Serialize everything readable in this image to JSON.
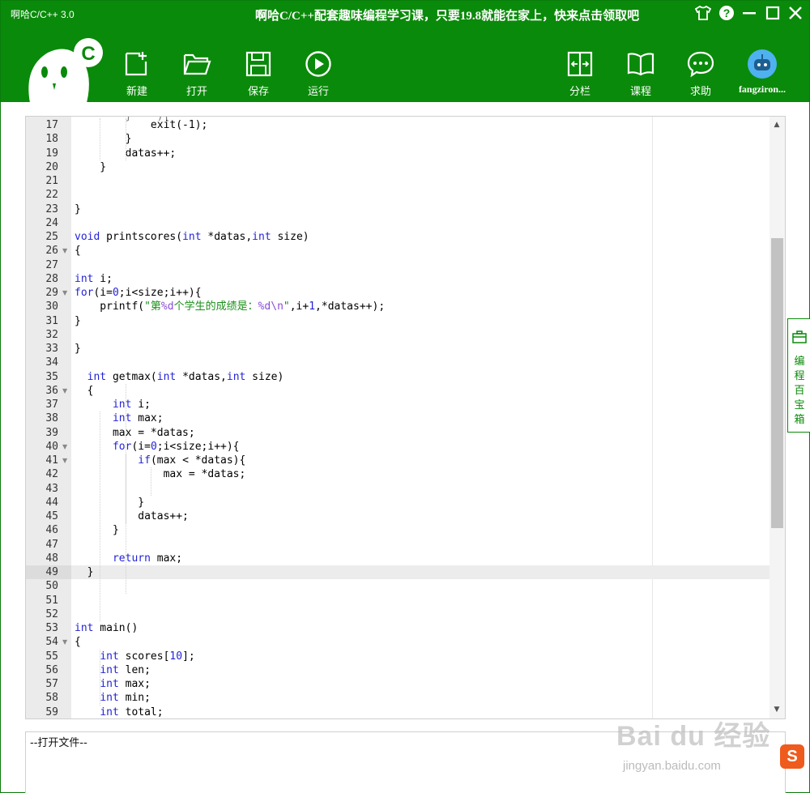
{
  "window": {
    "title": "啊哈C/C++ 3.0",
    "promo": "啊哈C/C++配套趣味编程学习课，只要19.8就能在家上，快来点击领取吧"
  },
  "toolbar": {
    "new_label": "新建",
    "open_label": "打开",
    "save_label": "保存",
    "run_label": "运行",
    "split_label": "分栏",
    "course_label": "课程",
    "help_label": "求助",
    "username": "fangziron..."
  },
  "logo": {
    "letter": "C"
  },
  "side_toolbox": {
    "label": "编程百宝箱"
  },
  "output": {
    "text": "--打开文件--"
  },
  "watermark": {
    "logo": "Bai du 经验",
    "url": "jingyan.baidu.com"
  },
  "ime": {
    "glyph": "S"
  },
  "colors": {
    "header_green": "#0a8a0a",
    "keyword_blue": "#2323d6",
    "string_green": "#1a8f1a"
  },
  "editor": {
    "highlighted_line": 49,
    "partial_top": "        }    ){",
    "lines": [
      {
        "n": 17,
        "fold": false,
        "code": [
          {
            "t": "            exit(-1);"
          }
        ]
      },
      {
        "n": 18,
        "fold": false,
        "code": [
          {
            "t": "        }"
          }
        ]
      },
      {
        "n": 19,
        "fold": false,
        "code": [
          {
            "t": "        datas++;"
          }
        ]
      },
      {
        "n": 20,
        "fold": false,
        "code": [
          {
            "t": "    }"
          }
        ]
      },
      {
        "n": 21,
        "fold": false,
        "code": [
          {
            "t": ""
          }
        ]
      },
      {
        "n": 22,
        "fold": false,
        "code": [
          {
            "t": ""
          }
        ]
      },
      {
        "n": 23,
        "fold": false,
        "code": [
          {
            "t": "}"
          }
        ]
      },
      {
        "n": 24,
        "fold": false,
        "code": [
          {
            "t": ""
          }
        ]
      },
      {
        "n": 25,
        "fold": false,
        "code": [
          {
            "t": "void",
            "c": "kw"
          },
          {
            "t": " printscores("
          },
          {
            "t": "int",
            "c": "kw"
          },
          {
            "t": " *datas,"
          },
          {
            "t": "int",
            "c": "kw"
          },
          {
            "t": " size)"
          }
        ]
      },
      {
        "n": 26,
        "fold": true,
        "code": [
          {
            "t": "{"
          }
        ]
      },
      {
        "n": 27,
        "fold": false,
        "code": [
          {
            "t": ""
          }
        ]
      },
      {
        "n": 28,
        "fold": false,
        "code": [
          {
            "t": "int",
            "c": "kw"
          },
          {
            "t": " i;"
          }
        ]
      },
      {
        "n": 29,
        "fold": true,
        "code": [
          {
            "t": "for",
            "c": "kw"
          },
          {
            "t": "(i="
          },
          {
            "t": "0",
            "c": "num"
          },
          {
            "t": ";i<size;i++){"
          }
        ]
      },
      {
        "n": 30,
        "fold": false,
        "code": [
          {
            "t": "    printf("
          },
          {
            "t": "\"第",
            "c": "str"
          },
          {
            "t": "%d",
            "c": "fmt"
          },
          {
            "t": "个学生的成绩是：",
            "c": "str"
          },
          {
            "t": "%d\\n",
            "c": "fmt"
          },
          {
            "t": "\"",
            "c": "str"
          },
          {
            "t": ",i+"
          },
          {
            "t": "1",
            "c": "num"
          },
          {
            "t": ",*datas++);"
          }
        ]
      },
      {
        "n": 31,
        "fold": false,
        "code": [
          {
            "t": "}"
          }
        ]
      },
      {
        "n": 32,
        "fold": false,
        "code": [
          {
            "t": ""
          }
        ]
      },
      {
        "n": 33,
        "fold": false,
        "code": [
          {
            "t": "}"
          }
        ]
      },
      {
        "n": 34,
        "fold": false,
        "code": [
          {
            "t": ""
          }
        ]
      },
      {
        "n": 35,
        "fold": false,
        "code": [
          {
            "t": "  "
          },
          {
            "t": "int",
            "c": "kw"
          },
          {
            "t": " getmax("
          },
          {
            "t": "int",
            "c": "kw"
          },
          {
            "t": " *datas,"
          },
          {
            "t": "int",
            "c": "kw"
          },
          {
            "t": " size)"
          }
        ]
      },
      {
        "n": 36,
        "fold": true,
        "code": [
          {
            "t": "  {"
          }
        ]
      },
      {
        "n": 37,
        "fold": false,
        "code": [
          {
            "t": "      "
          },
          {
            "t": "int",
            "c": "kw"
          },
          {
            "t": " i;"
          }
        ]
      },
      {
        "n": 38,
        "fold": false,
        "code": [
          {
            "t": "      "
          },
          {
            "t": "int",
            "c": "kw"
          },
          {
            "t": " max;"
          }
        ]
      },
      {
        "n": 39,
        "fold": false,
        "code": [
          {
            "t": "      max = *datas;"
          }
        ]
      },
      {
        "n": 40,
        "fold": true,
        "code": [
          {
            "t": "      "
          },
          {
            "t": "for",
            "c": "kw"
          },
          {
            "t": "(i="
          },
          {
            "t": "0",
            "c": "num"
          },
          {
            "t": ";i<size;i++){"
          }
        ]
      },
      {
        "n": 41,
        "fold": true,
        "code": [
          {
            "t": "          "
          },
          {
            "t": "if",
            "c": "kw"
          },
          {
            "t": "(max < *datas){"
          }
        ]
      },
      {
        "n": 42,
        "fold": false,
        "code": [
          {
            "t": "              max = *datas;"
          }
        ]
      },
      {
        "n": 43,
        "fold": false,
        "code": [
          {
            "t": ""
          }
        ]
      },
      {
        "n": 44,
        "fold": false,
        "code": [
          {
            "t": "          }"
          }
        ]
      },
      {
        "n": 45,
        "fold": false,
        "code": [
          {
            "t": "          datas++;"
          }
        ]
      },
      {
        "n": 46,
        "fold": false,
        "code": [
          {
            "t": "      }"
          }
        ]
      },
      {
        "n": 47,
        "fold": false,
        "code": [
          {
            "t": ""
          }
        ]
      },
      {
        "n": 48,
        "fold": false,
        "code": [
          {
            "t": "      "
          },
          {
            "t": "return",
            "c": "kw"
          },
          {
            "t": " max;"
          }
        ]
      },
      {
        "n": 49,
        "fold": false,
        "code": [
          {
            "t": "  }"
          }
        ]
      },
      {
        "n": 50,
        "fold": false,
        "code": [
          {
            "t": ""
          }
        ]
      },
      {
        "n": 51,
        "fold": false,
        "code": [
          {
            "t": ""
          }
        ]
      },
      {
        "n": 52,
        "fold": false,
        "code": [
          {
            "t": ""
          }
        ]
      },
      {
        "n": 53,
        "fold": false,
        "code": [
          {
            "t": "int",
            "c": "kw"
          },
          {
            "t": " main()"
          }
        ]
      },
      {
        "n": 54,
        "fold": true,
        "code": [
          {
            "t": "{"
          }
        ]
      },
      {
        "n": 55,
        "fold": false,
        "code": [
          {
            "t": "    "
          },
          {
            "t": "int",
            "c": "kw"
          },
          {
            "t": " scores["
          },
          {
            "t": "10",
            "c": "num"
          },
          {
            "t": "];"
          }
        ]
      },
      {
        "n": 56,
        "fold": false,
        "code": [
          {
            "t": "    "
          },
          {
            "t": "int",
            "c": "kw"
          },
          {
            "t": " len;"
          }
        ]
      },
      {
        "n": 57,
        "fold": false,
        "code": [
          {
            "t": "    "
          },
          {
            "t": "int",
            "c": "kw"
          },
          {
            "t": " max;"
          }
        ]
      },
      {
        "n": 58,
        "fold": false,
        "code": [
          {
            "t": "    "
          },
          {
            "t": "int",
            "c": "kw"
          },
          {
            "t": " min;"
          }
        ]
      },
      {
        "n": 59,
        "fold": false,
        "code": [
          {
            "t": "    "
          },
          {
            "t": "int",
            "c": "kw"
          },
          {
            "t": " total;"
          }
        ]
      }
    ]
  }
}
